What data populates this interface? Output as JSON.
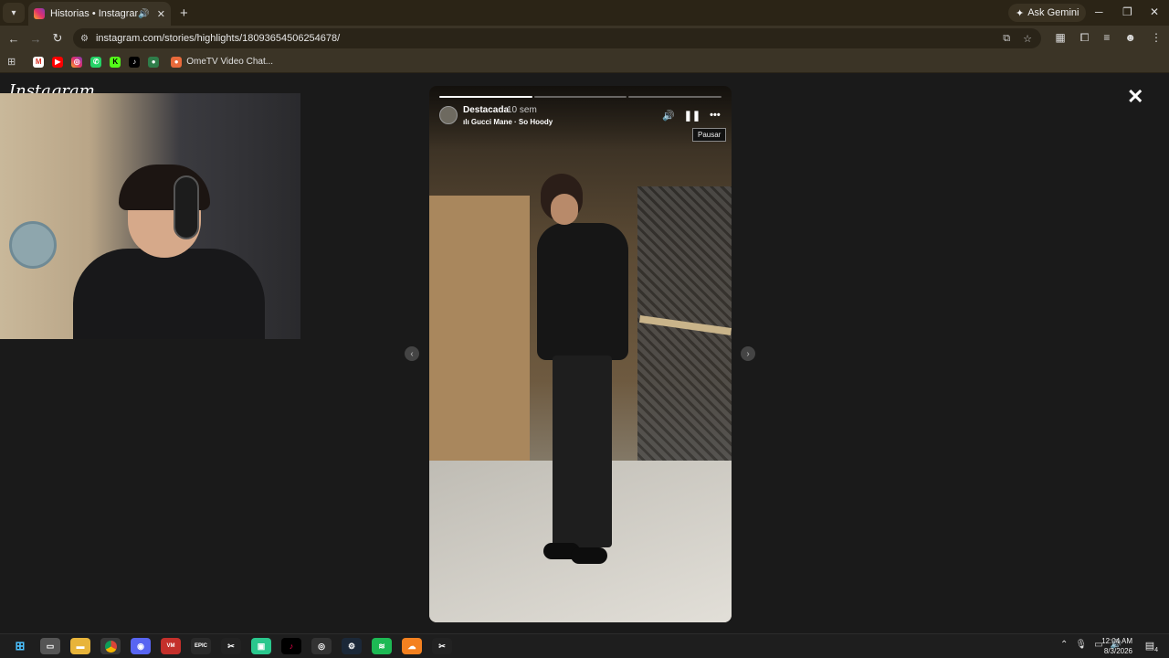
{
  "browser": {
    "tab_title": "Historias • Instagram",
    "new_tab": "+",
    "ask_gemini": "Ask Gemini",
    "url": "instagram.com/stories/highlights/18093654506254678/",
    "bookmark_label": "OmeTV Video Chat..."
  },
  "page": {
    "logo": "Instagram",
    "close": "✕",
    "prev": "‹",
    "next": "›"
  },
  "story": {
    "username": "Destacada",
    "time_ago": "10 sem",
    "music": "Gucci Mane · So Hoody",
    "tooltip": "Pausar",
    "progress": {
      "total_segments": 3,
      "completed_segments": 1
    }
  },
  "taskbar": {
    "time": "12:04 AM",
    "date": "8/3/2026",
    "notifications": "4"
  },
  "colors": {
    "browser_chrome": "#3b3426",
    "page_background": "#1a1a1a",
    "taskbar": "#1e1e1e"
  }
}
